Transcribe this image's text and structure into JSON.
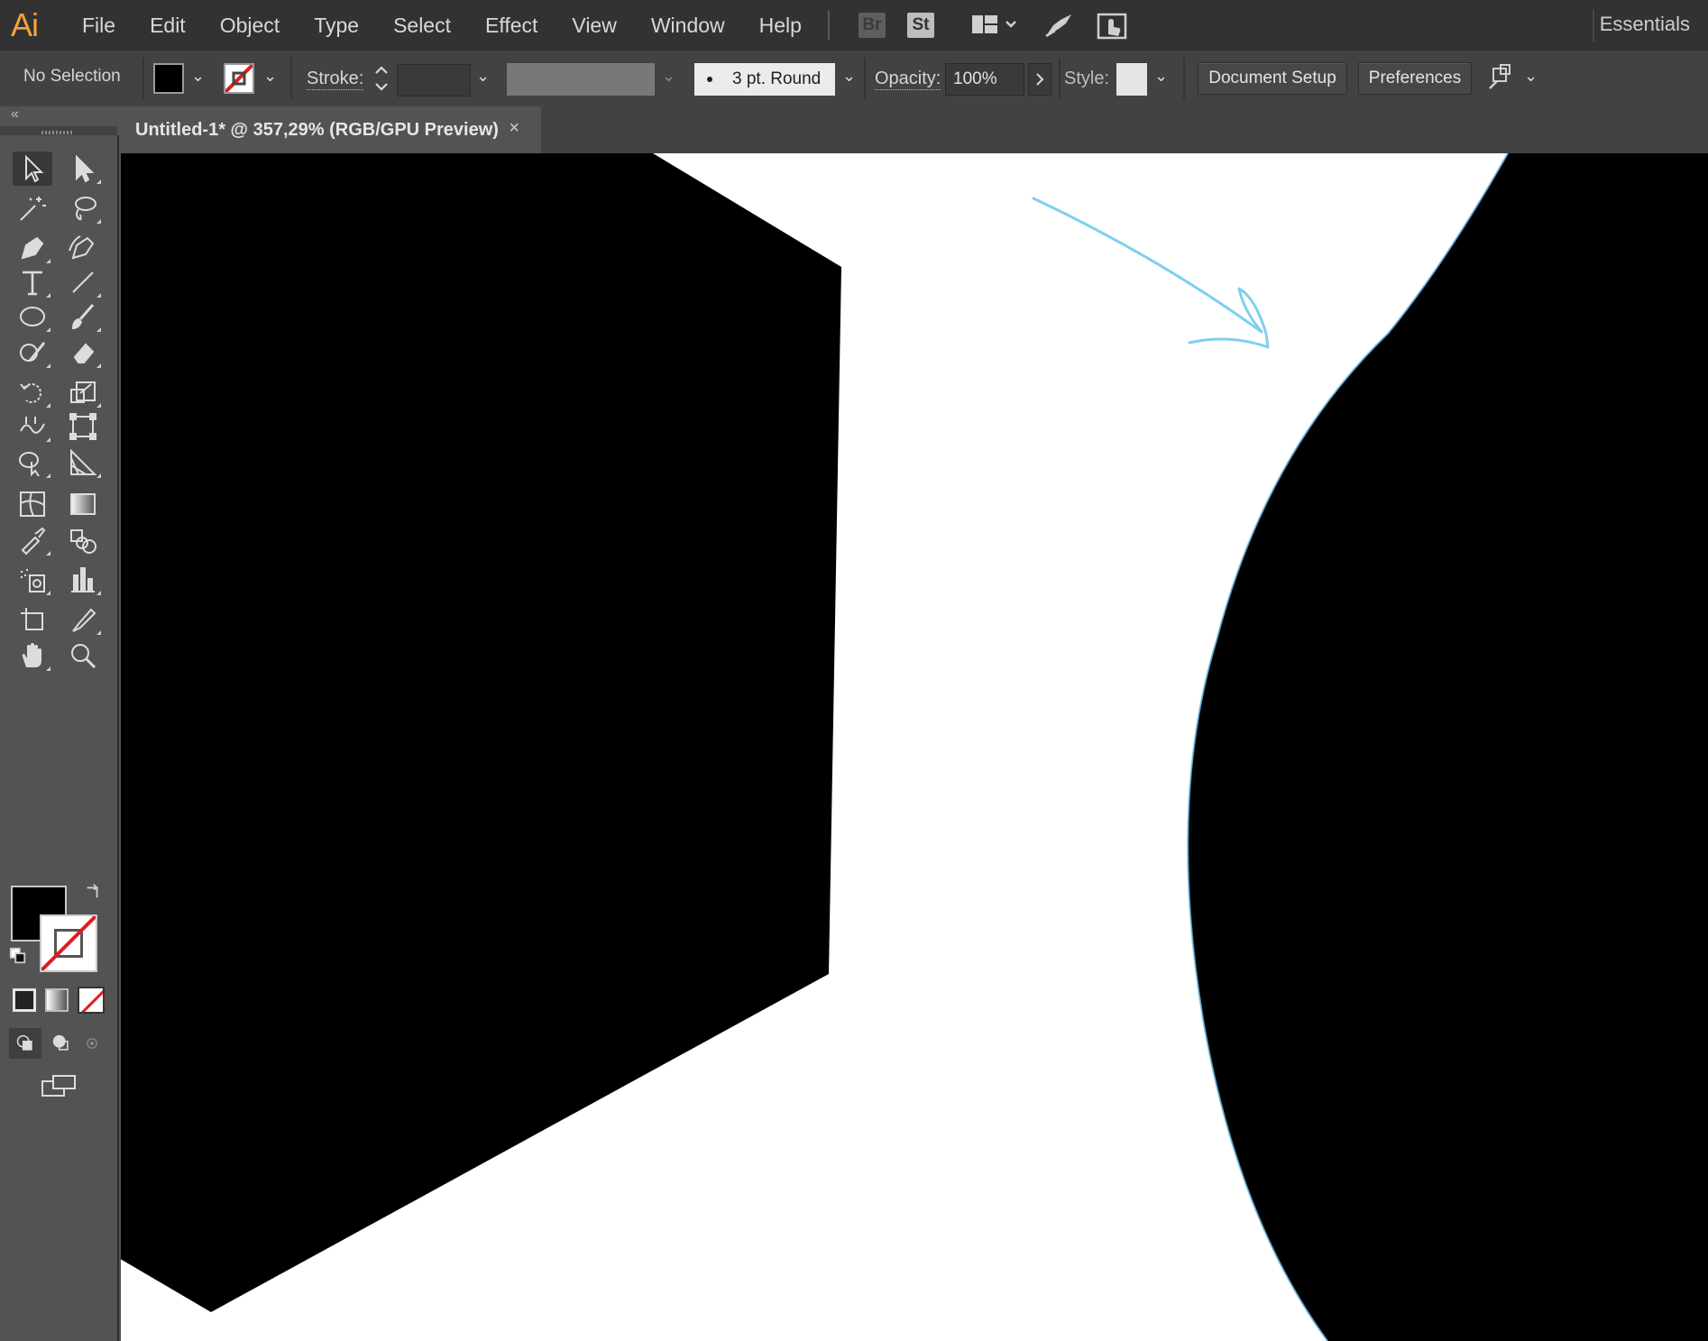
{
  "app": {
    "logo": "Ai",
    "menu": [
      "File",
      "Edit",
      "Object",
      "Type",
      "Select",
      "Effect",
      "View",
      "Window",
      "Help"
    ],
    "badges": {
      "bridge": "Br",
      "stock": "St"
    },
    "workspace": "Essentials",
    "icons": [
      "arrange-documents-icon",
      "gpu-performance-icon",
      "touch-workspace-icon"
    ]
  },
  "control_bar": {
    "selection": "No Selection",
    "fill_color": "#000000",
    "stroke_color": "none",
    "stroke_label": "Stroke:",
    "brush": "3 pt. Round",
    "opacity_label": "Opacity:",
    "opacity": "100%",
    "style_label": "Style:",
    "document_setup": "Document Setup",
    "preferences": "Preferences"
  },
  "document": {
    "tab_title": "Untitled-1* @ 357,29% (RGB/GPU Preview)",
    "close": "×"
  },
  "tools": [
    "selection-tool",
    "direct-selection-tool",
    "magic-wand-tool",
    "lasso-tool",
    "pen-tool",
    "curvature-tool",
    "type-tool",
    "line-segment-tool",
    "ellipse-tool",
    "paintbrush-tool",
    "shaper-tool",
    "eraser-tool",
    "rotate-tool",
    "scale-tool",
    "width-tool",
    "free-transform-tool",
    "shape-builder-tool",
    "perspective-grid-tool",
    "mesh-tool",
    "gradient-tool",
    "eyedropper-tool",
    "blend-tool",
    "symbol-sprayer-tool",
    "column-graph-tool",
    "artboard-tool",
    "slice-tool",
    "hand-tool",
    "zoom-tool"
  ],
  "colors": {
    "fill": "#000000",
    "stroke": "none",
    "annotation_arrow": "#7fcff0",
    "canvas": "#ffffff",
    "ui_dark": "#323232",
    "ui_panel": "#535353",
    "logo": "#f7a23b"
  }
}
